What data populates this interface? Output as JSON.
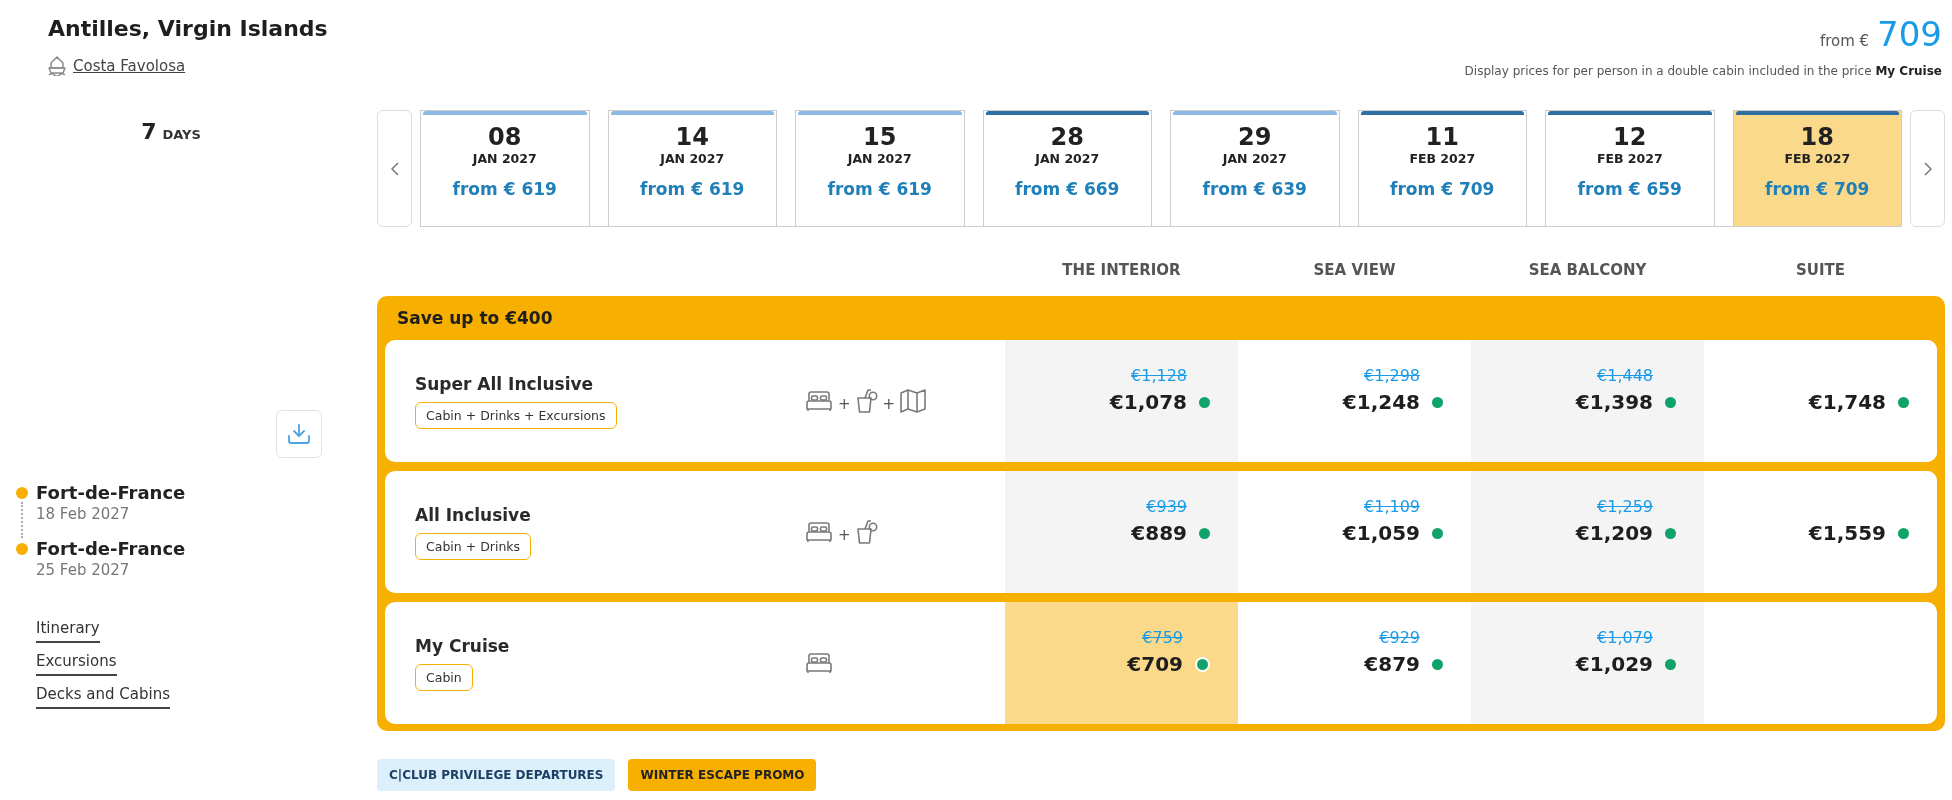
{
  "trip": {
    "title": "Antilles, Virgin Islands",
    "ship": "Costa Favolosa",
    "duration": {
      "number": "7",
      "unit": "DAYS"
    }
  },
  "price_summary": {
    "prefix": "from €",
    "amount": "709",
    "note": "Display prices for per person in a double cabin included in the price **My Cruise**"
  },
  "dates": [
    {
      "day": "08",
      "month": "JAN 2027",
      "price": "from € 619",
      "color": "#8db9e3",
      "selected": false
    },
    {
      "day": "14",
      "month": "JAN 2027",
      "price": "from € 619",
      "color": "#8db9e3",
      "selected": false
    },
    {
      "day": "15",
      "month": "JAN 2027",
      "price": "from € 619",
      "color": "#8db9e3",
      "selected": false
    },
    {
      "day": "28",
      "month": "JAN 2027",
      "price": "from € 669",
      "color": "#2f6ea3",
      "selected": false
    },
    {
      "day": "29",
      "month": "JAN 2027",
      "price": "from € 639",
      "color": "#8db9e3",
      "selected": false
    },
    {
      "day": "11",
      "month": "FEB 2027",
      "price": "from € 709",
      "color": "#2f6ea3",
      "selected": false
    },
    {
      "day": "12",
      "month": "FEB 2027",
      "price": "from € 659",
      "color": "#2f6ea3",
      "selected": false
    },
    {
      "day": "18",
      "month": "FEB 2027",
      "price": "from € 709",
      "color": "#2f6ea3",
      "selected": true
    }
  ],
  "itinerary": [
    {
      "port": "Fort-de-France",
      "date": "18 Feb 2027"
    },
    {
      "port": "Fort-de-France",
      "date": "25 Feb 2027"
    }
  ],
  "links": [
    "Itinerary",
    "Excursions",
    "Decks and Cabins"
  ],
  "cabin_columns": [
    "THE INTERIOR",
    "SEA VIEW",
    "SEA BALCONY",
    "SUITE"
  ],
  "promo": {
    "title": "Save up to €400",
    "rows": [
      {
        "name": "Super All Inclusive",
        "tag": "Cabin + Drinks + Excursions",
        "included": [
          {
            "kind": "cabin"
          },
          {
            "kind": "plus",
            "text": "+"
          },
          {
            "kind": "drinks"
          },
          {
            "kind": "plus",
            "text": "+"
          },
          {
            "kind": "excursions"
          }
        ],
        "prices": [
          {
            "old": "€1,128",
            "price": "€1,078",
            "available": true,
            "selected": false
          },
          {
            "old": "€1,298",
            "price": "€1,248",
            "available": true,
            "selected": false
          },
          {
            "old": "€1,448",
            "price": "€1,398",
            "available": true,
            "selected": false
          },
          {
            "price": "€1,748",
            "available": true,
            "selected": false
          }
        ]
      },
      {
        "name": "All Inclusive",
        "tag": "Cabin + Drinks",
        "included": [
          {
            "kind": "cabin"
          },
          {
            "kind": "plus",
            "text": "+"
          },
          {
            "kind": "drinks"
          }
        ],
        "prices": [
          {
            "old": "€939",
            "price": "€889",
            "available": true,
            "selected": false
          },
          {
            "old": "€1,109",
            "price": "€1,059",
            "available": true,
            "selected": false
          },
          {
            "old": "€1,259",
            "price": "€1,209",
            "available": true,
            "selected": false
          },
          {
            "price": "€1,559",
            "available": true,
            "selected": false
          }
        ]
      },
      {
        "name": "My Cruise",
        "tag": "Cabin",
        "included": [
          {
            "kind": "cabin"
          }
        ],
        "prices": [
          {
            "old": "€759",
            "price": "€709",
            "available": true,
            "selected": true
          },
          {
            "old": "€929",
            "price": "€879",
            "available": true,
            "selected": false
          },
          {
            "old": "€1,079",
            "price": "€1,029",
            "available": true,
            "selected": false
          }
        ]
      }
    ]
  },
  "tags": [
    {
      "label": "C|CLUB PRIVILEGE DEPARTURES",
      "kind": "club"
    },
    {
      "label": "WINTER ESCAPE PROMO",
      "kind": "promo"
    }
  ]
}
